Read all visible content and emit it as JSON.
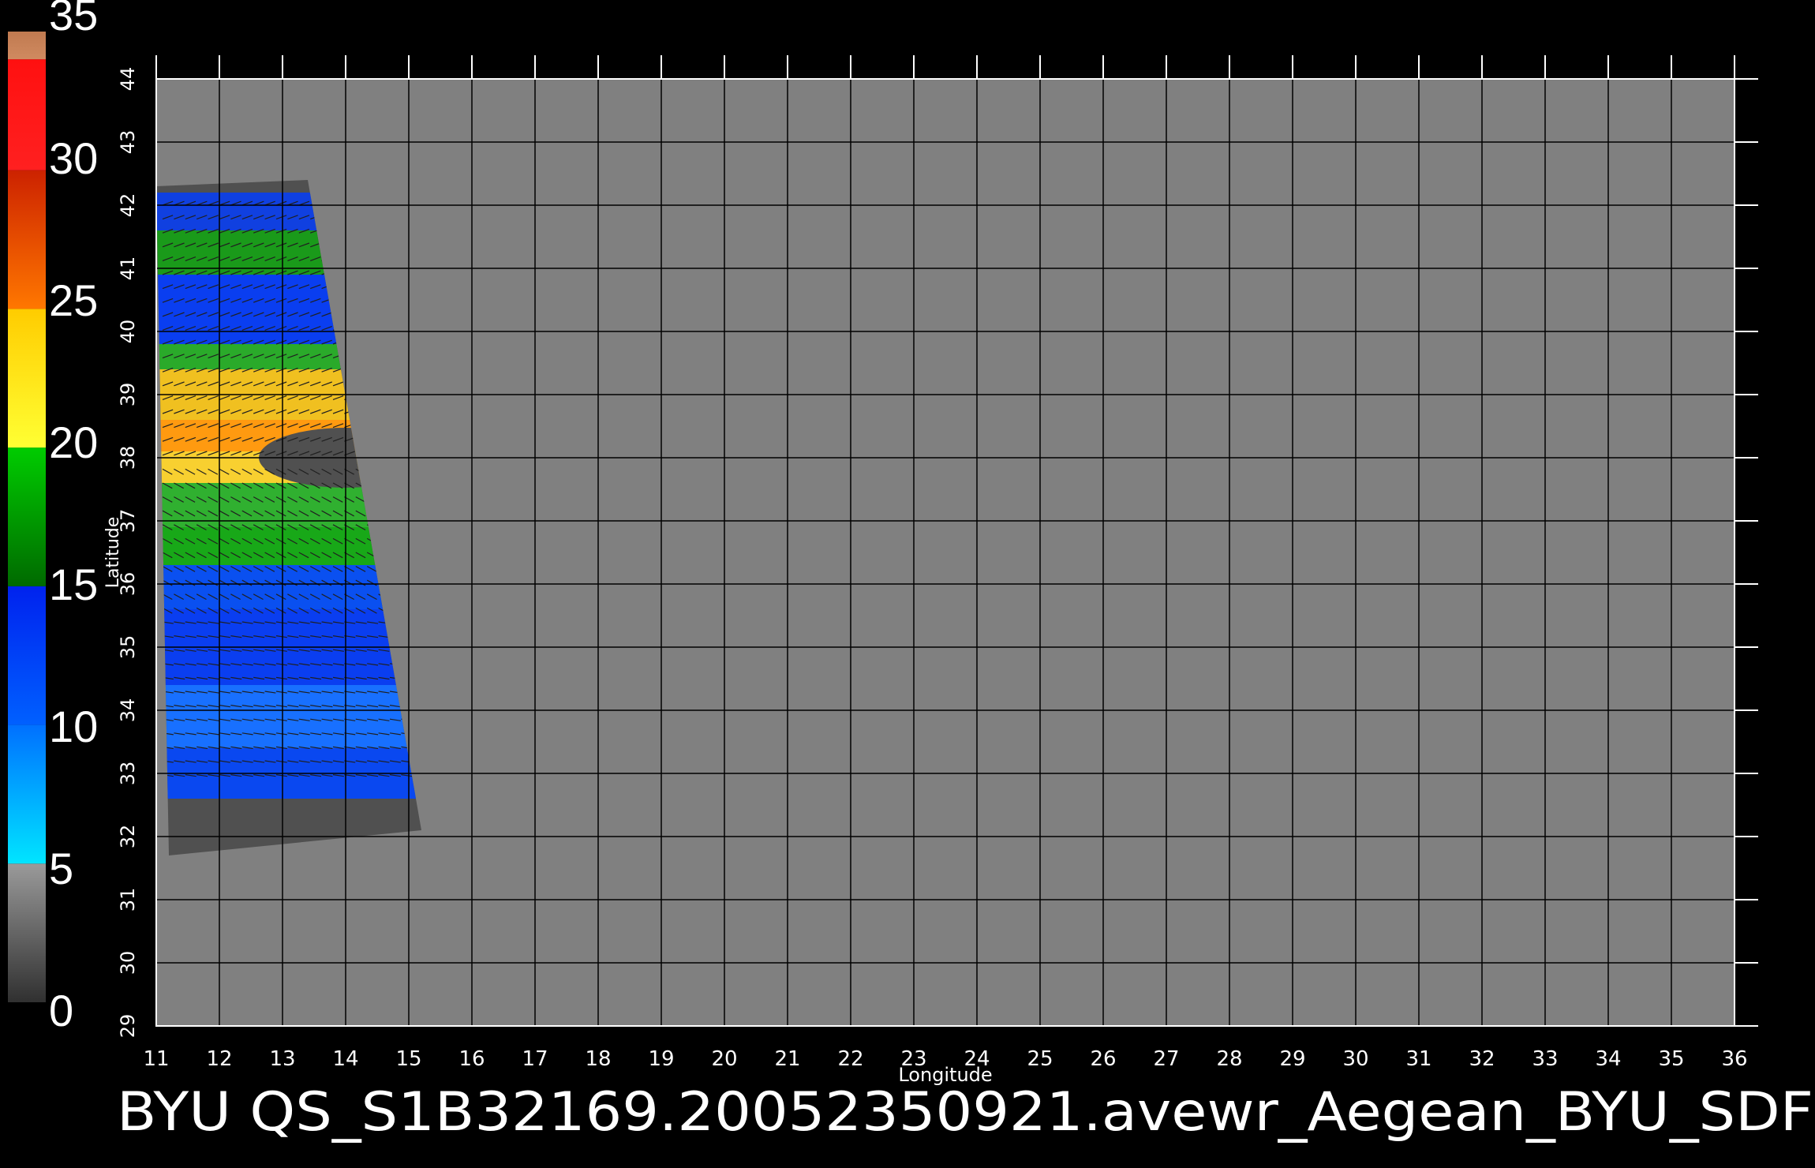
{
  "colorbar": {
    "labels": [
      "35",
      "30",
      "25",
      "20",
      "15",
      "10",
      "5",
      "0"
    ],
    "stops": [
      {
        "from": 0,
        "to": 5,
        "color_top": "#9a9a9a",
        "color_bottom": "#303030"
      },
      {
        "from": 5,
        "to": 10,
        "color_top": "#0070ff",
        "color_bottom": "#00e5ff"
      },
      {
        "from": 10,
        "to": 15,
        "color_top": "#0022ee",
        "color_bottom": "#0060ff"
      },
      {
        "from": 15,
        "to": 20,
        "color_top": "#00cc00",
        "color_bottom": "#006a00"
      },
      {
        "from": 20,
        "to": 25,
        "color_top": "#ffcc00",
        "color_bottom": "#ffff33"
      },
      {
        "from": 25,
        "to": 30,
        "color_top": "#cc2200",
        "color_bottom": "#ff7700"
      },
      {
        "from": 30,
        "to": 34,
        "color_top": "#ff1010",
        "color_bottom": "#ff2020"
      },
      {
        "from": 34,
        "to": 35,
        "color_top": "#c07a50",
        "color_bottom": "#d08a60"
      }
    ]
  },
  "map": {
    "xlabel": "Longitude",
    "ylabel": "Latitude",
    "lon_ticks": [
      "11",
      "12",
      "13",
      "14",
      "15",
      "16",
      "17",
      "18",
      "19",
      "20",
      "21",
      "22",
      "23",
      "24",
      "25",
      "26",
      "27",
      "28",
      "29",
      "30",
      "31",
      "32",
      "33",
      "34",
      "35",
      "36"
    ],
    "lat_ticks": [
      "29",
      "30",
      "31",
      "32",
      "33",
      "34",
      "35",
      "36",
      "37",
      "38",
      "39",
      "40",
      "41",
      "42",
      "43",
      "44"
    ],
    "lon_range": [
      11,
      36
    ],
    "lat_range": [
      29,
      44
    ],
    "background_color": "#808080",
    "grid_color": "#000000",
    "swath_nodata_color": "#505050",
    "swath_corners_lonlat": [
      [
        11.0,
        42.3
      ],
      [
        13.4,
        42.4
      ],
      [
        15.2,
        32.1
      ],
      [
        11.2,
        31.7
      ]
    ]
  },
  "footer": {
    "title": "BYU  QS_S1B32169.20052350921.avewr_Aegean_BYU_SDF"
  },
  "colors": {
    "background": "#000000",
    "text": "#ffffff"
  }
}
